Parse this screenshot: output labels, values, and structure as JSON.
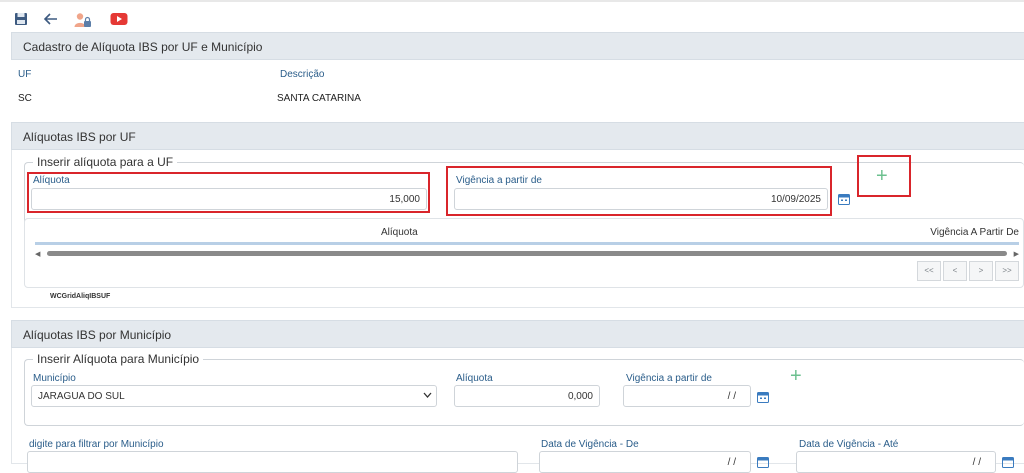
{
  "toolbar": {
    "save_icon": "save-icon",
    "back_icon": "back-arrow-icon",
    "user_lock_icon": "user-lock-icon",
    "youtube_icon": "youtube-icon"
  },
  "header": {
    "title": "Cadastro de Alíquota IBS por UF e Município"
  },
  "uf_info": {
    "uf_label": "UF",
    "uf_value": "SC",
    "desc_label": "Descrição",
    "desc_value": "SANTA CATARINA"
  },
  "uf_section": {
    "title": "Alíquotas IBS por UF",
    "legend": "Inserir alíquota para a UF",
    "aliquota_label": "Alíquota",
    "aliquota_value": "15,000",
    "vigencia_label": "Vigência a partir de",
    "vigencia_value": "10/09/2025",
    "add_symbol": "+",
    "grid_col1": "Alíquota",
    "grid_col2": "Vigência A Partir De",
    "grid_name": "WCGridAliqIBSUF",
    "pager": [
      "<<",
      "<",
      ">",
      ">>"
    ]
  },
  "mun_section": {
    "title": "Alíquotas IBS por Município",
    "legend": "Inserir Alíquota para Município",
    "municipio_label": "Município",
    "municipio_value": "JARAGUA DO SUL",
    "aliquota_label": "Alíquota",
    "aliquota_value": "0,000",
    "vigencia_label": "Vigência a partir de",
    "vigencia_value": "/ /",
    "add_symbol": "+",
    "filter_label": "digite para filtrar por Município",
    "data_de_label": "Data de Vigência - De",
    "data_ate_label": "Data de Vigência - Até",
    "data_de_value": "/ /",
    "data_ate_value": "/ /"
  },
  "colors": {
    "accent": "#2a5d8a",
    "highlight": "#d9252b",
    "add": "#6cc08f",
    "youtube": "#e53935"
  }
}
